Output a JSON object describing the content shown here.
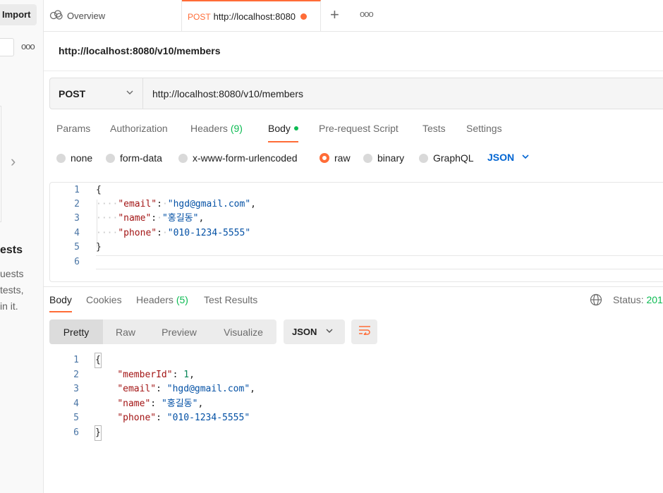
{
  "sidebar": {
    "import_label": "Import",
    "more_icon": "ooo",
    "heading_fragment": "ests",
    "text_fragments": [
      "uests",
      "tests,",
      "in it."
    ]
  },
  "tabs": {
    "overview_label": "Overview",
    "active_method": "POST",
    "active_url": "http://localhost:8080",
    "new_tab": "+",
    "more": "ooo"
  },
  "request": {
    "title": "http://localhost:8080/v10/members",
    "method": "POST",
    "url": "http://localhost:8080/v10/members",
    "tabs": [
      {
        "label": "Params"
      },
      {
        "label": "Authorization"
      },
      {
        "label": "Headers",
        "count": "(9)"
      },
      {
        "label": "Body"
      },
      {
        "label": "Pre-request Script"
      },
      {
        "label": "Tests"
      },
      {
        "label": "Settings"
      }
    ],
    "body_types": [
      "none",
      "form-data",
      "x-www-form-urlencoded",
      "raw",
      "binary",
      "GraphQL"
    ],
    "selected_body_type": "raw",
    "language": "JSON",
    "body_lines": [
      {
        "n": "1",
        "text": "{"
      },
      {
        "n": "2",
        "key": "\"email\"",
        "value": "\"hgd@gmail.com\""
      },
      {
        "n": "3",
        "key": "\"name\"",
        "value": "\"홍길동\""
      },
      {
        "n": "4",
        "key": "\"phone\"",
        "value": "\"010-1234-5555\""
      },
      {
        "n": "5",
        "text": "}"
      },
      {
        "n": "6",
        "text": ""
      }
    ]
  },
  "response": {
    "tabs": [
      {
        "label": "Body"
      },
      {
        "label": "Cookies"
      },
      {
        "label": "Headers",
        "count": "(5)"
      },
      {
        "label": "Test Results"
      }
    ],
    "status_label": "Status:",
    "status_code": "201",
    "view_modes": [
      "Pretty",
      "Raw",
      "Preview",
      "Visualize"
    ],
    "format": "JSON",
    "body_lines": [
      {
        "n": "1",
        "text": "{"
      },
      {
        "n": "2",
        "key": "\"memberId\"",
        "value": "1"
      },
      {
        "n": "3",
        "key": "\"email\"",
        "value": "\"hgd@gmail.com\""
      },
      {
        "n": "4",
        "key": "\"name\"",
        "value": "\"홍길동\""
      },
      {
        "n": "5",
        "key": "\"phone\"",
        "value": "\"010-1234-5555\""
      },
      {
        "n": "6",
        "text": "}"
      }
    ]
  },
  "colors": {
    "accent": "#ff6c37",
    "success": "#0cbb52",
    "link_blue": "#0265d2",
    "json_key": "#a31515",
    "json_string": "#0451a5",
    "json_number": "#098658"
  }
}
